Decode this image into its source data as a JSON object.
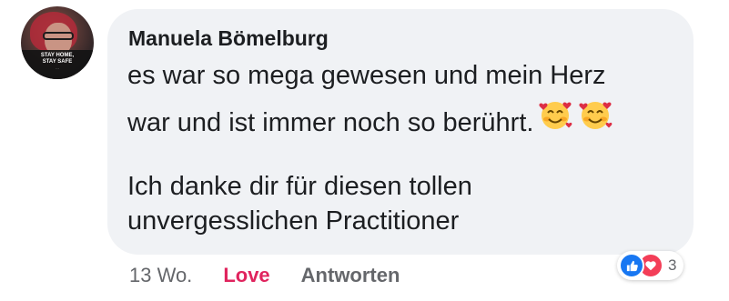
{
  "avatar": {
    "banner_line1": "STAY HOME,",
    "banner_line2": "STAY SAFE",
    "banner_small": "…"
  },
  "comment": {
    "author": "Manuela Bömelburg",
    "lines": [
      "es war so mega gewesen und mein Herz",
      "war und ist immer noch so berührt.",
      "Ich danke dir für diesen tollen",
      "unvergesslichen Practitioner"
    ],
    "emoji_name": "smiling-face-with-hearts-icon"
  },
  "actions": {
    "timestamp": "13 Wo.",
    "love_label": "Love",
    "reply_label": "Antworten"
  },
  "reactions": {
    "types": [
      "like-icon",
      "love-icon"
    ],
    "count": "3"
  },
  "colors": {
    "bubble": "#f0f2f5",
    "text": "#1c1e21",
    "muted": "#65676b",
    "love": "#e0245e",
    "like_blue": "#1877f2",
    "heart_red": "#f33e58"
  }
}
